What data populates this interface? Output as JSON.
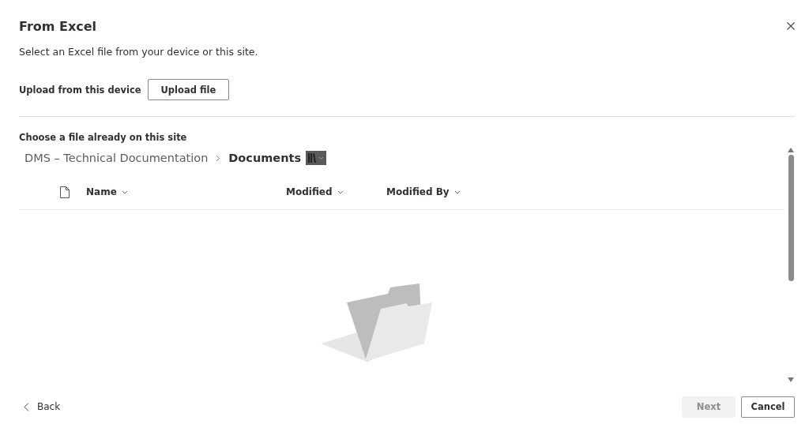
{
  "dialog": {
    "title": "From Excel",
    "description": "Select an Excel file from your device or this site."
  },
  "upload": {
    "label": "Upload from this device",
    "button": "Upload file"
  },
  "site_section": {
    "label": "Choose a file already on this site"
  },
  "breadcrumb": [
    {
      "label": "DMS – Technical Documentation",
      "current": false
    },
    {
      "label": "Documents",
      "current": true
    }
  ],
  "table": {
    "columns": [
      {
        "label": "Name"
      },
      {
        "label": "Modified"
      },
      {
        "label": "Modified By"
      }
    ]
  },
  "footer": {
    "back": "Back",
    "buttons": [
      {
        "label": "Next",
        "disabled": true
      },
      {
        "label": "Cancel",
        "disabled": false
      }
    ]
  }
}
